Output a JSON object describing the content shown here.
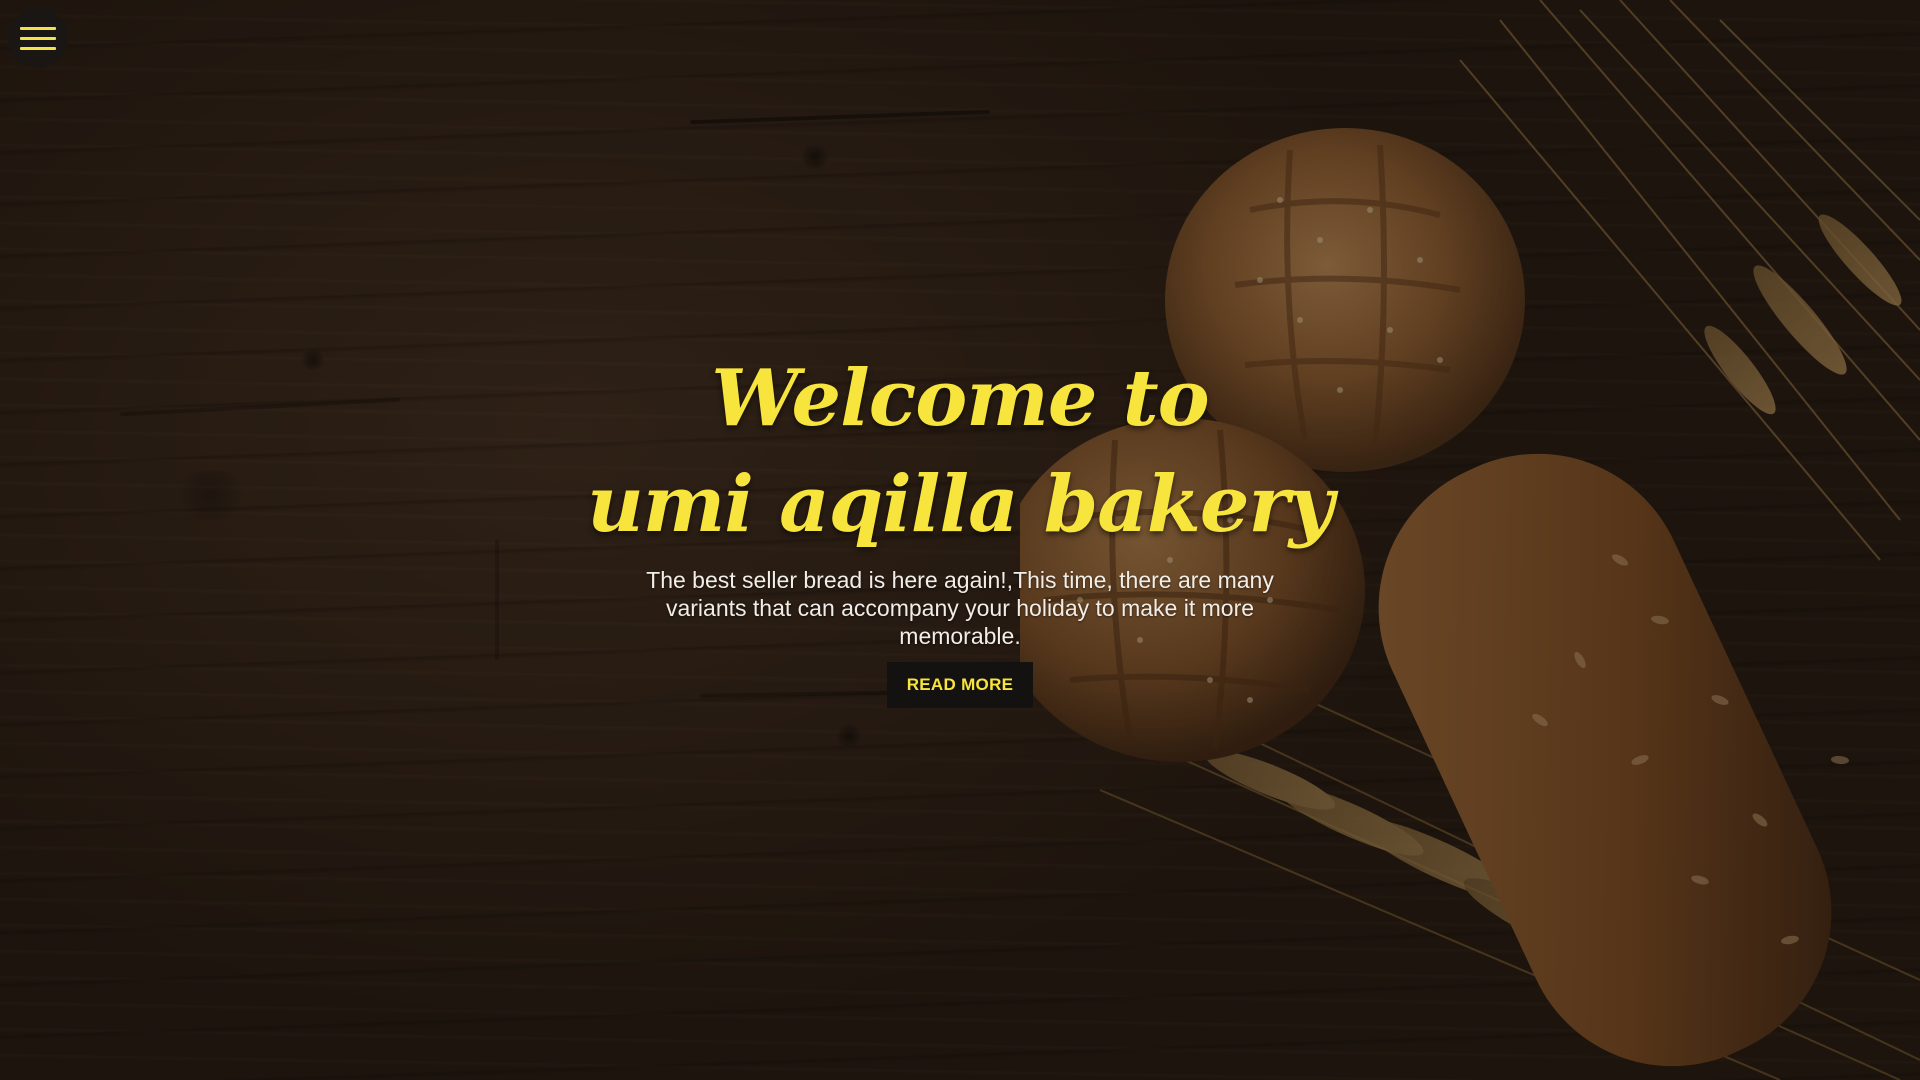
{
  "nav": {
    "menu_icon": "hamburger-menu-icon"
  },
  "hero": {
    "title_line_1": "Welcome to",
    "title_line_2": "umi aqilla bakery",
    "tagline": "The best seller bread is here again!,This time, there are many variants that can accompany your holiday to make it more memorable.",
    "cta_label": "READ MORE"
  },
  "colors": {
    "accent": "#f7e43d",
    "button_bg": "#141211",
    "overlay": "#1a1613",
    "text_light": "#f2ede6"
  }
}
